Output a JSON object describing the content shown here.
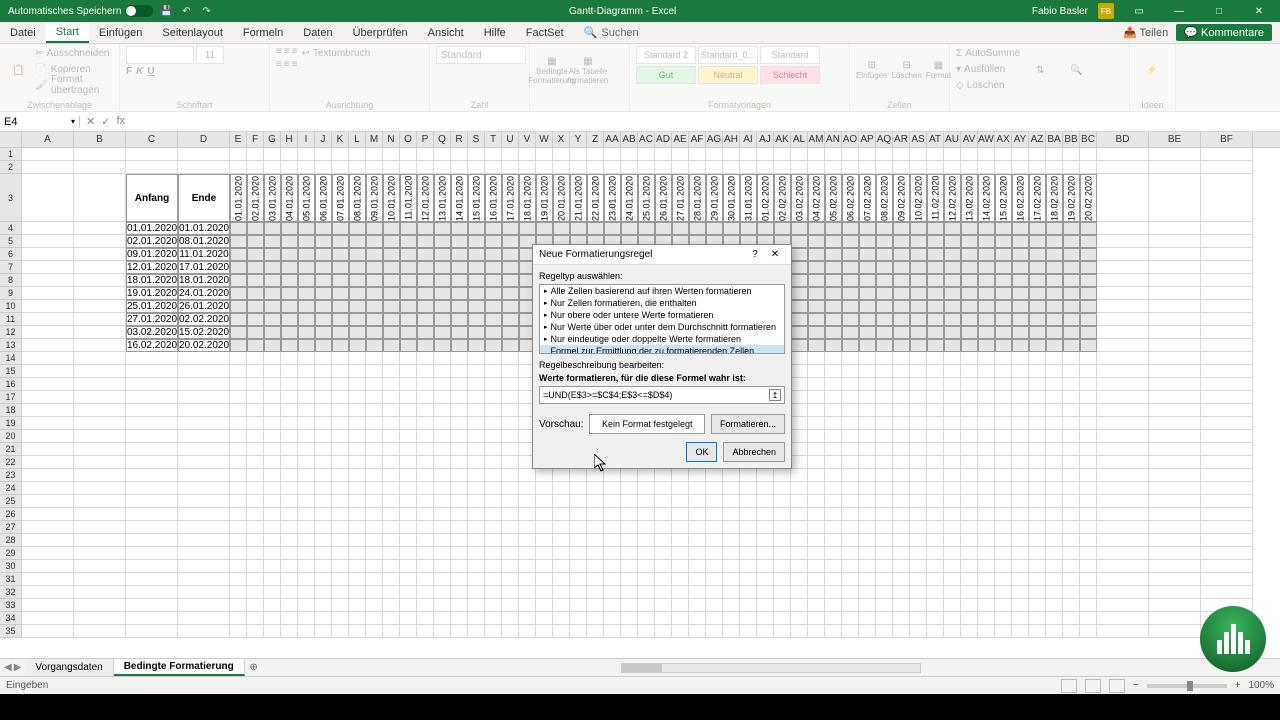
{
  "title_bar": {
    "autosave": "Automatisches Speichern",
    "doc_title": "Gantt-Diagramm - Excel",
    "user_name": "Fabio Basler",
    "user_initials": "FB"
  },
  "tabs": {
    "datei": "Datei",
    "start": "Start",
    "einfuegen": "Einfügen",
    "seitenlayout": "Seitenlayout",
    "formeln": "Formeln",
    "daten": "Daten",
    "ueberpruefen": "Überprüfen",
    "ansicht": "Ansicht",
    "hilfe": "Hilfe",
    "factset": "FactSet",
    "suchen": "Suchen",
    "teilen": "Teilen",
    "kommentare": "Kommentare"
  },
  "ribbon": {
    "clipboard": {
      "ausschneiden": "Ausschneiden",
      "kopieren": "Kopieren",
      "format_uebertragen": "Format übertragen",
      "label": "Zwischenablage"
    },
    "font": {
      "size": "11",
      "label": "Schriftart"
    },
    "align": {
      "textumbruch": "Textumbruch",
      "label": "Ausrichtung"
    },
    "number": {
      "standard": "Standard",
      "label": "Zahl"
    },
    "condfmt": {
      "bedingte": "Bedingte Formatierung",
      "als_tabelle": "Als Tabelle formatieren"
    },
    "styles": {
      "standard2": "Standard 2",
      "standard0": "Standard_0...",
      "standard": "Standard",
      "gut": "Gut",
      "neutral": "Neutral",
      "schlecht": "Schlecht",
      "label": "Formatvorlagen"
    },
    "cells": {
      "einfuegen": "Einfügen",
      "loeschen": "Löschen",
      "format": "Format",
      "label": "Zellen"
    },
    "editing": {
      "autosumme": "AutoSumme",
      "ausfuellen": "Ausfüllen",
      "loeschen": "Löschen",
      "sortieren": "Sortieren und Filtern",
      "suchen": "Suchen und Auswählen"
    },
    "ideas": {
      "label": "Ideen"
    }
  },
  "formula_bar": {
    "name_box": "E4"
  },
  "columns": {
    "letters_wide": [
      "A",
      "B",
      "C",
      "D"
    ],
    "letters_narrow": [
      "E",
      "F",
      "G",
      "H",
      "I",
      "J",
      "K",
      "L",
      "M",
      "N",
      "O",
      "P",
      "Q",
      "R",
      "S",
      "T",
      "U",
      "V",
      "W",
      "X",
      "Y",
      "Z",
      "AA",
      "AB",
      "AC",
      "AD",
      "AE",
      "AF",
      "AG",
      "AH",
      "AI",
      "AJ",
      "AK",
      "AL",
      "AM",
      "AN",
      "AO",
      "AP",
      "AQ",
      "AR",
      "AS",
      "AT",
      "AU",
      "AV",
      "AW",
      "AX",
      "AY",
      "AZ",
      "BA",
      "BB",
      "BC"
    ],
    "letters_tail": [
      "BD",
      "BE",
      "BF"
    ]
  },
  "headers": {
    "anfang": "Anfang",
    "ende": "Ende"
  },
  "date_headers": [
    "01.01.2020",
    "02.01.2020",
    "03.01.2020",
    "04.01.2020",
    "05.01.2020",
    "06.01.2020",
    "07.01.2020",
    "08.01.2020",
    "09.01.2020",
    "10.01.2020",
    "11.01.2020",
    "12.01.2020",
    "13.01.2020",
    "14.01.2020",
    "15.01.2020",
    "16.01.2020",
    "17.01.2020",
    "18.01.2020",
    "19.01.2020",
    "20.01.2020",
    "21.01.2020",
    "22.01.2020",
    "23.01.2020",
    "24.01.2020",
    "25.01.2020",
    "26.01.2020",
    "27.01.2020",
    "28.01.2020",
    "29.01.2020",
    "30.01.2020",
    "31.01.2020",
    "01.02.2020",
    "02.02.2020",
    "03.02.2020",
    "04.02.2020",
    "05.02.2020",
    "06.02.2020",
    "07.02.2020",
    "08.02.2020",
    "09.02.2020",
    "10.02.2020",
    "11.02.2020",
    "12.02.2020",
    "13.02.2020",
    "14.02.2020",
    "15.02.2020",
    "16.02.2020",
    "17.02.2020",
    "18.02.2020",
    "19.02.2020",
    "20.02.2020"
  ],
  "data_rows": [
    {
      "start": "01.01.2020",
      "end": "01.01.2020"
    },
    {
      "start": "02.01.2020",
      "end": "08.01.2020"
    },
    {
      "start": "09.01.2020",
      "end": "11.01.2020"
    },
    {
      "start": "12.01.2020",
      "end": "17.01.2020"
    },
    {
      "start": "18.01.2020",
      "end": "18.01.2020"
    },
    {
      "start": "19.01.2020",
      "end": "24.01.2020"
    },
    {
      "start": "25.01.2020",
      "end": "26.01.2020"
    },
    {
      "start": "27.01.2020",
      "end": "02.02.2020"
    },
    {
      "start": "03.02.2020",
      "end": "15.02.2020"
    },
    {
      "start": "16.02.2020",
      "end": "20.02.2020"
    }
  ],
  "dialog": {
    "title": "Neue Formatierungsregel",
    "regeltyp": "Regeltyp auswählen:",
    "rules": [
      "Alle Zellen basierend auf ihren Werten formatieren",
      "Nur Zellen formatieren, die enthalten",
      "Nur obere oder untere Werte formatieren",
      "Nur Werte über oder unter dem Durchschnitt formatieren",
      "Nur eindeutige oder doppelte Werte formatieren",
      "Formel zur Ermittlung der zu formatierenden Zellen verwenden"
    ],
    "beschreibung": "Regelbeschreibung bearbeiten:",
    "werte_label": "Werte formatieren, für die diese Formel wahr ist:",
    "formula": "=UND(E$3>=$C$4;E$3<=$D$4)",
    "vorschau": "Vorschau:",
    "no_format": "Kein Format festgelegt",
    "formatieren": "Formatieren...",
    "ok": "OK",
    "abbrechen": "Abbrechen"
  },
  "sheets": {
    "vorgangsdaten": "Vorgangsdaten",
    "bedingte": "Bedingte Formatierung"
  },
  "status_bar": {
    "eingeben": "Eingeben",
    "zoom": "100%"
  }
}
